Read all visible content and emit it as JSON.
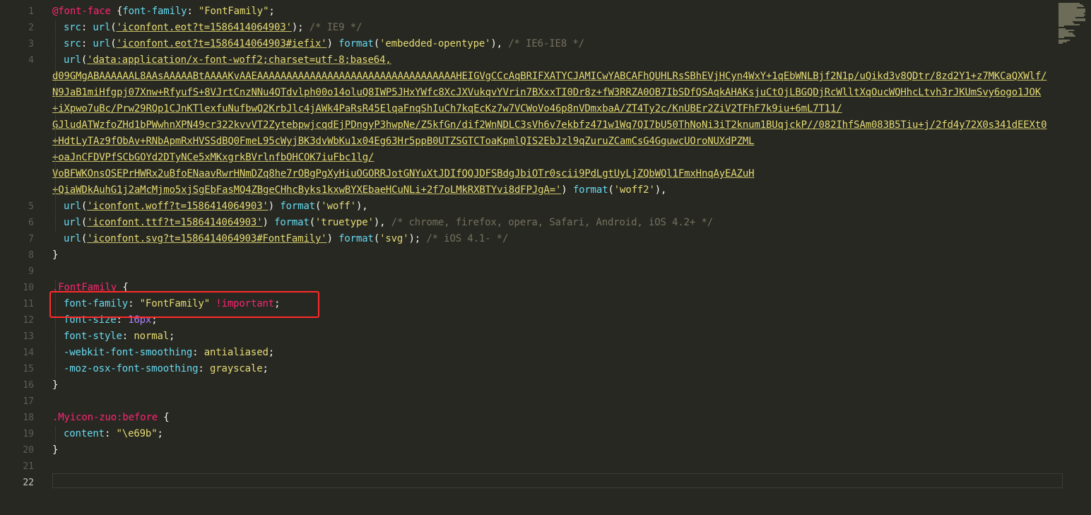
{
  "editor": {
    "active_line": "22",
    "lines": [
      {
        "n": "1",
        "parts": [
          [
            "kw-at",
            "@font-face"
          ],
          [
            "brace",
            " {"
          ],
          [
            "prop",
            "font-family"
          ],
          [
            "punc",
            ": "
          ],
          [
            "str",
            "\"FontFamily\""
          ],
          [
            "punc",
            ";"
          ]
        ]
      },
      {
        "n": "2",
        "parts": [
          [
            "ind",
            ""
          ],
          [
            "prop",
            "src"
          ],
          [
            "punc",
            ": "
          ],
          [
            "func",
            "url"
          ],
          [
            "punc",
            "("
          ],
          [
            "str u",
            "'iconfont.eot?t=1586414064903'"
          ],
          [
            "punc",
            ");"
          ],
          [
            "cmt",
            " /* IE9 */"
          ]
        ]
      },
      {
        "n": "3",
        "parts": [
          [
            "ind",
            ""
          ],
          [
            "prop",
            "src"
          ],
          [
            "punc",
            ": "
          ],
          [
            "func",
            "url"
          ],
          [
            "punc",
            "("
          ],
          [
            "str u",
            "'iconfont.eot?t=1586414064903#iefix'"
          ],
          [
            "punc",
            ") "
          ],
          [
            "func",
            "format"
          ],
          [
            "punc",
            "("
          ],
          [
            "str",
            "'embedded-opentype'"
          ],
          [
            "punc",
            "),"
          ],
          [
            "cmt",
            " /* IE6-IE8 */"
          ]
        ]
      },
      {
        "n": "4",
        "parts": [
          [
            "ind",
            ""
          ],
          [
            "func",
            "url"
          ],
          [
            "punc",
            "("
          ],
          [
            "str u",
            "'data:application/x-font-woff2;charset=utf-8;base64,"
          ]
        ]
      },
      {
        "n": "",
        "parts": [
          [
            "b64",
            "d09GMgABAAAAAAL8AAsAAAAABtAAAAKvAAEAAAAAAAAAAAAAAAAAAAAAAAAAAAAAAAAAAHEIGVgCCcAqBRIFXATYCJAMICwYABCAFhQUHLRsSBhEVjHCyn4WxY+1qEbWNLBjf2N1p/uQikd3v8QDtr/8zd2Y1+z7MKCaQXWlf/"
          ]
        ]
      },
      {
        "n": "",
        "parts": [
          [
            "b64",
            "N9JaB1miHfgpj07Xnw+RfyufS+8VJrtCnzNNu4QTdvlph00o14oluQ8IWP5JHxYWfc8XcJXVukqvYVrin7BXxxTI0Dr8z+fW3RRZA0OB7IbSDfQSAqkAHAKsjuCtOjLBGQDjRcWlltXqOucWQHhcLtvh3rJKUmSvy6ogo1JOK"
          ]
        ]
      },
      {
        "n": "",
        "parts": [
          [
            "b64",
            "+iXpwo7uBc/Prw29RQp1CJnKTlexfuNufbwQ2KrbJlc4jAWk4PaRsR45ElqaFnqShIuCh7kqEcKz7w7VCWoVo46p8nVDmxbaA/ZT4Ty2c/KnUBEr2ZiV2TFhF7k9iu+6mL7T11/"
          ]
        ]
      },
      {
        "n": "",
        "parts": [
          [
            "b64",
            "GJludATWzfoZHd1bPWwhnXPN49cr322kvvVT2ZytebpwjcqdEjPDngyP3hwpNe/Z5kfGn/dif2WnNDLC3sVh6v7ekbfz471w1Wq7QI7bU50ThNoNi3iT2knum1BUqjckP//082IhfSAm083B5Tiu+j/2fd4y72X0s341dEEXt0"
          ]
        ]
      },
      {
        "n": "",
        "parts": [
          [
            "b64",
            "+HdtLyTAz9fObAv+RNbApmRxHVSSdBQ0FmeL95cWyjBK3dvWbKu1x04Eg63Hr5ppB0UTZSGTCToaKpmlQIS2EbJzl9qZuruZCamCsG4GguwcUOroNUXdPZML"
          ]
        ]
      },
      {
        "n": "",
        "parts": [
          [
            "b64",
            "+oaJnCFDVPfSCbGOYd2DTyNCe5xMKxgrkBVrlnfbOHCOK7iuFbc1lg/"
          ]
        ]
      },
      {
        "n": "",
        "parts": [
          [
            "b64",
            "VoBFWKOnsOSEPrHWRx2uBfoENaavRwrHNmDZq8he7rOBgPgXyHiuOGORRJotGNYuXtJDIfQQJDFSBdgJbiOTr0scii9PdLgtUyLjZQbWQl1FmxHnqAyEAZuH"
          ]
        ]
      },
      {
        "n": "",
        "parts": [
          [
            "b64",
            "+QiaWDkAuhG1j2aMcMjmo5xjSgEbFasMQ4ZBgeCHhcByks1kxwBYXEbaeHCuNLi+2f7oLMkRXBTYvi8dFPJgA='"
          ],
          [
            "punc",
            ") "
          ],
          [
            "func",
            "format"
          ],
          [
            "punc",
            "("
          ],
          [
            "str",
            "'woff2'"
          ],
          [
            "punc",
            "),"
          ]
        ]
      },
      {
        "n": "5",
        "parts": [
          [
            "ind",
            ""
          ],
          [
            "func",
            "url"
          ],
          [
            "punc",
            "("
          ],
          [
            "str u",
            "'iconfont.woff?t=1586414064903'"
          ],
          [
            "punc",
            ") "
          ],
          [
            "func",
            "format"
          ],
          [
            "punc",
            "("
          ],
          [
            "str",
            "'woff'"
          ],
          [
            "punc",
            "),"
          ]
        ]
      },
      {
        "n": "6",
        "parts": [
          [
            "ind",
            ""
          ],
          [
            "func",
            "url"
          ],
          [
            "punc",
            "("
          ],
          [
            "str u",
            "'iconfont.ttf?t=1586414064903'"
          ],
          [
            "punc",
            ") "
          ],
          [
            "func",
            "format"
          ],
          [
            "punc",
            "("
          ],
          [
            "str",
            "'truetype'"
          ],
          [
            "punc",
            "),"
          ],
          [
            "cmt",
            " /* chrome, firefox, opera, Safari, Android, iOS 4.2+ */"
          ]
        ]
      },
      {
        "n": "7",
        "parts": [
          [
            "ind",
            ""
          ],
          [
            "func",
            "url"
          ],
          [
            "punc",
            "("
          ],
          [
            "str u",
            "'iconfont.svg?t=1586414064903#FontFamily'"
          ],
          [
            "punc",
            ") "
          ],
          [
            "func",
            "format"
          ],
          [
            "punc",
            "("
          ],
          [
            "str",
            "'svg'"
          ],
          [
            "punc",
            ");"
          ],
          [
            "cmt",
            " /* iOS 4.1- */"
          ]
        ]
      },
      {
        "n": "8",
        "parts": [
          [
            "brace",
            "}"
          ]
        ]
      },
      {
        "n": "9",
        "parts": []
      },
      {
        "n": "10",
        "parts": [
          [
            "sel",
            ".FontFamily"
          ],
          [
            "brace",
            " {"
          ]
        ]
      },
      {
        "n": "11",
        "parts": [
          [
            "ind",
            ""
          ],
          [
            "prop",
            "font-family"
          ],
          [
            "punc",
            ": "
          ],
          [
            "str",
            "\"FontFamily\""
          ],
          [
            "imp",
            " !important"
          ],
          [
            "punc",
            ";"
          ]
        ]
      },
      {
        "n": "12",
        "parts": [
          [
            "ind",
            ""
          ],
          [
            "prop",
            "font-size"
          ],
          [
            "punc",
            ": "
          ],
          [
            "num",
            "16px"
          ],
          [
            "punc",
            ";"
          ]
        ]
      },
      {
        "n": "13",
        "parts": [
          [
            "ind",
            ""
          ],
          [
            "prop",
            "font-style"
          ],
          [
            "punc",
            ": "
          ],
          [
            "val",
            "normal"
          ],
          [
            "punc",
            ";"
          ]
        ]
      },
      {
        "n": "14",
        "parts": [
          [
            "ind",
            ""
          ],
          [
            "prop",
            "-webkit-font-smoothing"
          ],
          [
            "punc",
            ": "
          ],
          [
            "val",
            "antialiased"
          ],
          [
            "punc",
            ";"
          ]
        ]
      },
      {
        "n": "15",
        "parts": [
          [
            "ind",
            ""
          ],
          [
            "prop",
            "-moz-osx-font-smoothing"
          ],
          [
            "punc",
            ": "
          ],
          [
            "val",
            "grayscale"
          ],
          [
            "punc",
            ";"
          ]
        ]
      },
      {
        "n": "16",
        "parts": [
          [
            "brace",
            "}"
          ]
        ]
      },
      {
        "n": "17",
        "parts": []
      },
      {
        "n": "18",
        "parts": [
          [
            "sel",
            ".Myicon-zuo:before"
          ],
          [
            "brace",
            " {"
          ]
        ]
      },
      {
        "n": "19",
        "parts": [
          [
            "ind",
            ""
          ],
          [
            "prop",
            "content"
          ],
          [
            "punc",
            ": "
          ],
          [
            "str",
            "\"\\e69b\""
          ],
          [
            "punc",
            ";"
          ]
        ]
      },
      {
        "n": "20",
        "parts": [
          [
            "brace",
            "}"
          ]
        ]
      },
      {
        "n": "21",
        "parts": []
      },
      {
        "n": "22",
        "parts": []
      }
    ]
  },
  "colors": {
    "background": "#272822",
    "highlight_box": "#ff2a2a",
    "selector": "#f92672",
    "property": "#66d9ef",
    "string": "#e6db74",
    "comment": "#75715e"
  }
}
